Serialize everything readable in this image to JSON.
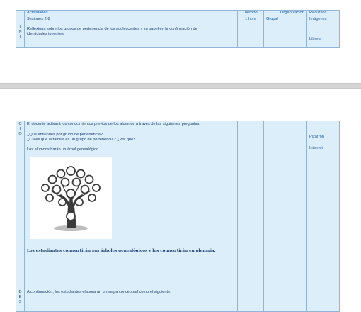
{
  "top_table": {
    "headers": [
      "Actividades",
      "Tiempo",
      "Organización",
      "Recursos"
    ],
    "side_letters": [
      "I",
      "N",
      "I"
    ],
    "session": "Sesiones 2-8",
    "reflection": "Reflexiona sobre los grupos de pertenencia de los adolescentes y su papel en la confirmación de identidades juveniles.",
    "tiempo": "1 hora",
    "organizacion": "Grupal",
    "recursos": [
      "Imágenes",
      "Libreta"
    ]
  },
  "cierre_table": {
    "side_letters": [
      "C",
      "I",
      "O"
    ],
    "intro": "El docente activará los conocimientos previos de los alumnos a través de las siguientes preguntas:",
    "q1": "¿Qué entiendes por grupo de pertenencia?",
    "q2": "¿Crees que la familia es un grupo de pertenencia? ¿Por qué?",
    "task": "Los alumnos  harán  un árbol genealógico.",
    "tree_icon": "family-tree-image",
    "closing": "Los estudiantes compartirán sus árboles genealógicos y los compartirán en plenaria:",
    "recursos": [
      "Pizarrón",
      "Internet"
    ]
  },
  "desarrollo_table": {
    "side_letters": [
      "D",
      "E",
      "S"
    ],
    "text": "A continuación, los estudiantes elaborarán un mapa conceptual como el siguiente:"
  },
  "colors": {
    "cell_bg": "#dceefa",
    "border": "#8fb5d9",
    "header_text": "#1f5ea8",
    "text": "#1f3f73",
    "separator": "#d4d4d4"
  }
}
